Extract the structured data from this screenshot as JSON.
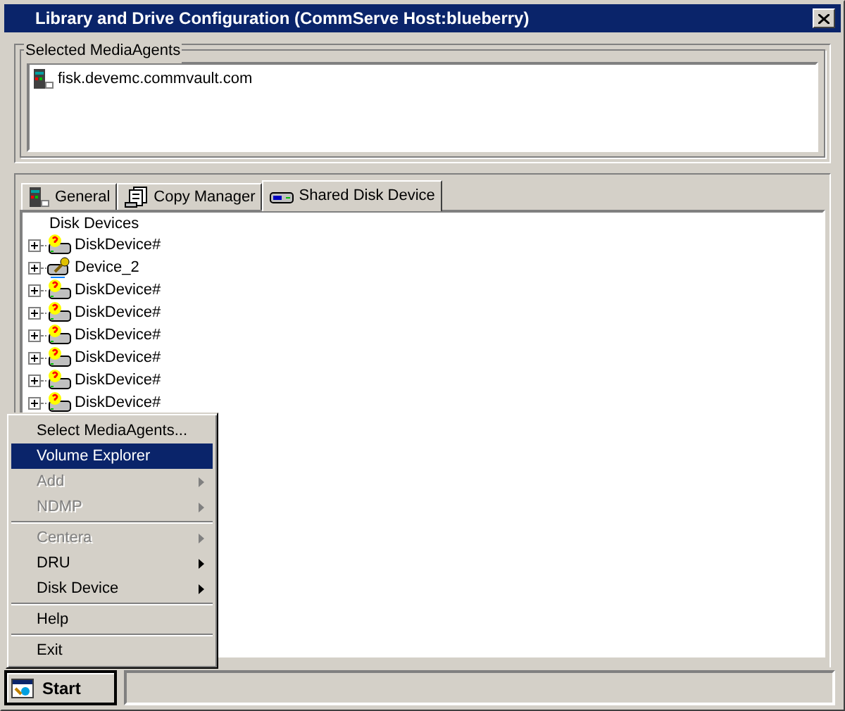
{
  "window": {
    "title": "Library and Drive Configuration (CommServe Host:blueberry)"
  },
  "media_agents": {
    "label": "Selected MediaAgents",
    "items": [
      "fisk.devemc.commvault.com"
    ]
  },
  "tabs": [
    {
      "label": "General",
      "kind": "server",
      "selected": false
    },
    {
      "label": "Copy Manager",
      "kind": "copy",
      "selected": false
    },
    {
      "label": "Shared Disk Device",
      "kind": "disk",
      "selected": true
    }
  ],
  "tree": {
    "root": "Disk Devices",
    "items": [
      {
        "label": "DiskDevice#",
        "kind": "unknown",
        "expanded": false
      },
      {
        "label": "Device_2",
        "kind": "device",
        "expanded": false
      },
      {
        "label": "DiskDevice#",
        "kind": "unknown",
        "expanded": false
      },
      {
        "label": "DiskDevice#",
        "kind": "unknown",
        "expanded": false
      },
      {
        "label": "DiskDevice#",
        "kind": "unknown",
        "expanded": false
      },
      {
        "label": "DiskDevice#",
        "kind": "unknown",
        "expanded": false
      },
      {
        "label": "DiskDevice#",
        "kind": "unknown",
        "expanded": false
      },
      {
        "label": "DiskDevice#",
        "kind": "unknown",
        "expanded": false
      }
    ]
  },
  "menu": {
    "groups": [
      [
        {
          "label": "Select MediaAgents...",
          "disabled": false,
          "selected": false,
          "submenu": false
        },
        {
          "label": "Volume Explorer",
          "disabled": false,
          "selected": true,
          "submenu": false
        },
        {
          "label": "Add",
          "disabled": true,
          "selected": false,
          "submenu": true
        },
        {
          "label": "NDMP",
          "disabled": true,
          "selected": false,
          "submenu": true
        }
      ],
      [
        {
          "label": "Centera",
          "disabled": true,
          "selected": false,
          "submenu": true
        },
        {
          "label": "DRU",
          "disabled": false,
          "selected": false,
          "submenu": true
        },
        {
          "label": "Disk Device",
          "disabled": false,
          "selected": false,
          "submenu": true
        }
      ],
      [
        {
          "label": "Help",
          "disabled": false,
          "selected": false,
          "submenu": false
        }
      ],
      [
        {
          "label": "Exit",
          "disabled": false,
          "selected": false,
          "submenu": false
        }
      ]
    ]
  },
  "start_button": {
    "label": "Start"
  }
}
